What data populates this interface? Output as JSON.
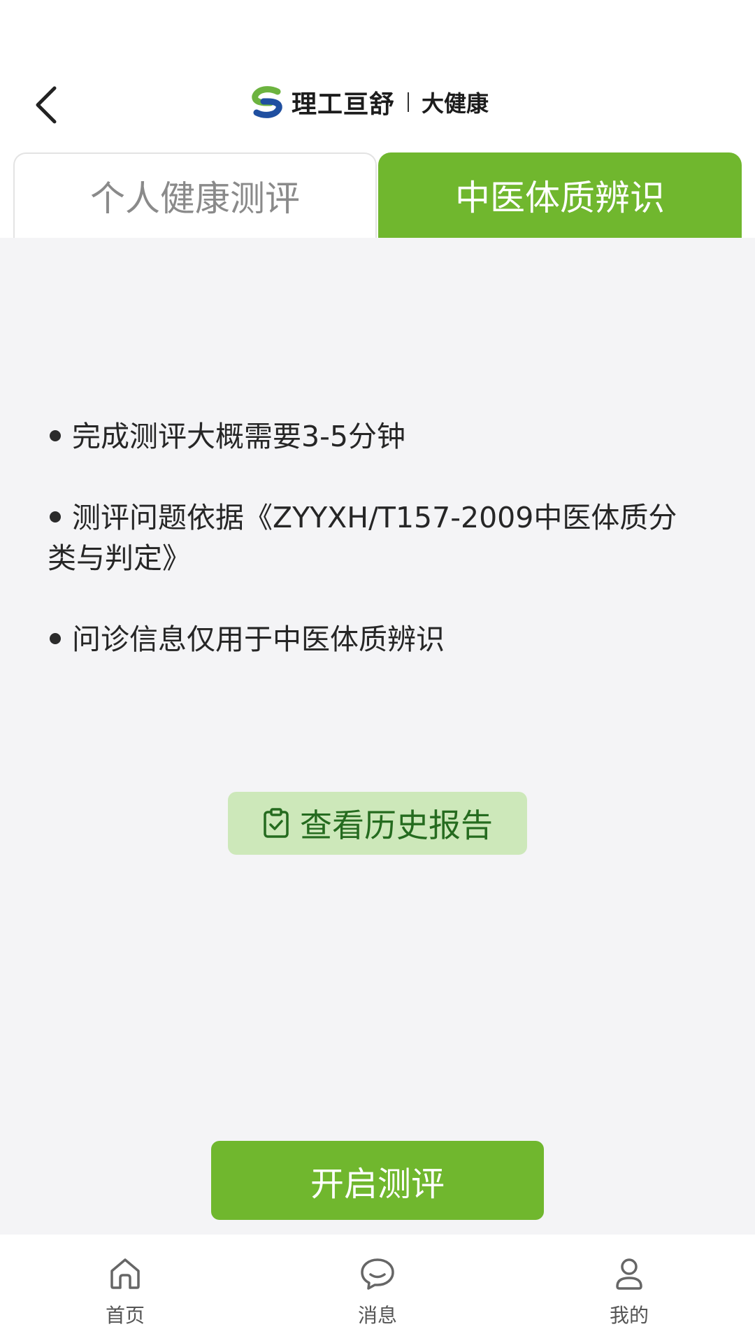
{
  "header": {
    "logo_brand": "理工亘舒",
    "logo_sub": "大健康"
  },
  "tabs": [
    {
      "label": "个人健康测评",
      "active": false
    },
    {
      "label": "中医体质辨识",
      "active": true
    }
  ],
  "content": {
    "bullets": [
      "完成测评大概需要3-5分钟",
      "测评问题依据《ZYYXH/T157-2009中医体质分类与判定》",
      "问诊信息仅用于中医体质辨识"
    ],
    "history_button": "查看历史报告",
    "start_button": "开启测评"
  },
  "bottom_nav": [
    {
      "label": "首页",
      "icon": "home-icon"
    },
    {
      "label": "消息",
      "icon": "message-icon"
    },
    {
      "label": "我的",
      "icon": "user-icon"
    }
  ],
  "colors": {
    "accent": "#70b72e",
    "accent_light": "#cde8ba",
    "accent_text": "#256b1f",
    "background": "#f4f4f6"
  }
}
